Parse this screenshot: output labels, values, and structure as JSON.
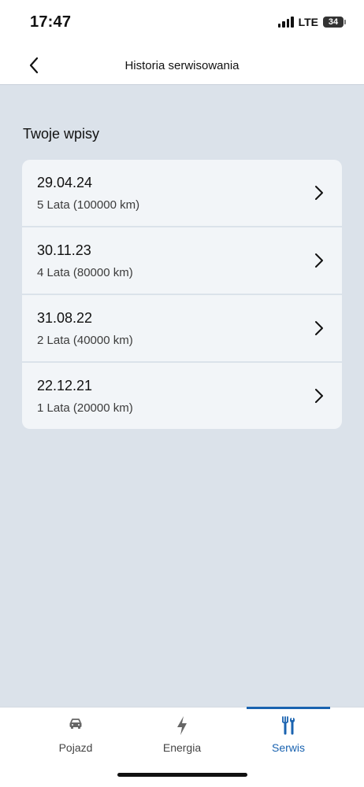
{
  "status_bar": {
    "time": "17:47",
    "network": "LTE",
    "battery": "34"
  },
  "header": {
    "title": "Historia serwisowania",
    "back_icon": "chevron-left-icon"
  },
  "section": {
    "title": "Twoje wpisy"
  },
  "entries": [
    {
      "date": "29.04.24",
      "detail": "5 Lata (100000 km)"
    },
    {
      "date": "30.11.23",
      "detail": "4 Lata (80000 km)"
    },
    {
      "date": "31.08.22",
      "detail": "2 Lata (40000 km)"
    },
    {
      "date": "22.12.21",
      "detail": "1 Lata (20000 km)"
    }
  ],
  "tabs": [
    {
      "label": "Pojazd",
      "icon": "car-icon",
      "active": false
    },
    {
      "label": "Energia",
      "icon": "lightning-icon",
      "active": false
    },
    {
      "label": "Serwis",
      "icon": "tools-icon",
      "active": true
    }
  ],
  "colors": {
    "background": "#dbe2ea",
    "card": "#f2f5f8",
    "accent": "#1a63b0"
  }
}
